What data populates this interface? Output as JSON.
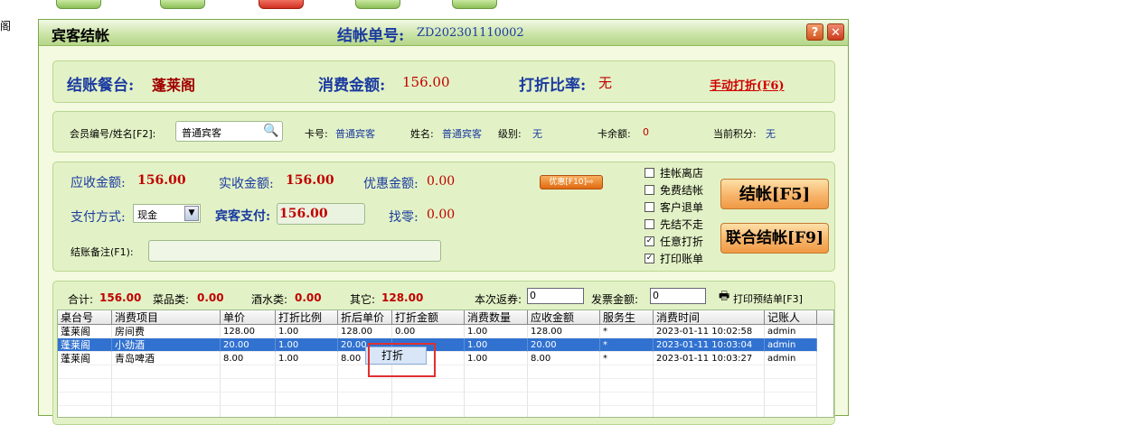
{
  "side_text": "阁",
  "dialog": {
    "title": "宾客结帐",
    "bill_label": "结帐单号:",
    "bill_no": "ZD202301110002"
  },
  "summary": {
    "table_label": "结账餐台:",
    "table_value": "蓬莱阁",
    "amount_label": "消费金额:",
    "amount_value": "156.00",
    "discount_rate_label": "打折比率:",
    "discount_rate_value": "无",
    "manual_discount_link": "手动打折(F6)"
  },
  "member": {
    "id_label": "会员编号/姓名[F2]:",
    "id_value": "普通宾客",
    "card_label": "卡号:",
    "card_value": "普通宾客",
    "name_label": "姓名:",
    "name_value": "普通宾客",
    "level_label": "级别:",
    "level_value": "无",
    "balance_label": "卡余额:",
    "balance_value": "0",
    "points_label": "当前积分:",
    "points_value": "无"
  },
  "payment": {
    "receivable_label": "应收金额:",
    "receivable_value": "156.00",
    "actual_label": "实收金额:",
    "actual_value": "156.00",
    "discount_label": "优惠金额:",
    "discount_value": "0.00",
    "promo_button": "优惠[F10]⇨",
    "method_label": "支付方式:",
    "method_value": "现金",
    "guest_pay_label": "宾客支付:",
    "guest_pay_value": "156.00",
    "change_label": "找零:",
    "change_value": "0.00",
    "remark_label": "结账备注(F1):",
    "remark_value": ""
  },
  "options": [
    {
      "label": "挂帐离店",
      "checked": false
    },
    {
      "label": "免费结帐",
      "checked": false
    },
    {
      "label": "客户退单",
      "checked": false
    },
    {
      "label": "先结不走",
      "checked": false
    },
    {
      "label": "任意打折",
      "checked": true
    },
    {
      "label": "打印账单",
      "checked": true
    }
  ],
  "buttons": {
    "checkout": "结帐[F5]",
    "joint_checkout": "联合结帐[F9]"
  },
  "totals": {
    "total_label": "合计:",
    "total_value": "156.00",
    "dish_label": "菜品类:",
    "dish_value": "0.00",
    "drink_label": "酒水类:",
    "drink_value": "0.00",
    "other_label": "其它:",
    "other_value": "128.00",
    "rebate_label": "本次返券:",
    "rebate_value": "0",
    "invoice_label": "发票金额:",
    "invoice_value": "0",
    "print_pre_label": "打印预结单[F3]"
  },
  "table": {
    "columns": [
      "桌台号",
      "消费项目",
      "单价",
      "打折比例",
      "折后单价",
      "打折金额",
      "消费数量",
      "应收金额",
      "服务生",
      "消费时间",
      "记账人"
    ],
    "rows": [
      [
        "蓬莱阁",
        "房间费",
        "128.00",
        "1.00",
        "128.00",
        "0.00",
        "1.00",
        "128.00",
        "*",
        "2023-01-11 10:02:58",
        "admin"
      ],
      [
        "蓬莱阁",
        "小劲酒",
        "20.00",
        "1.00",
        "20.00",
        "",
        "1.00",
        "20.00",
        "*",
        "2023-01-11 10:03:04",
        "admin"
      ],
      [
        "蓬莱阁",
        "青岛啤酒",
        "8.00",
        "1.00",
        "8.00",
        "",
        "1.00",
        "8.00",
        "*",
        "2023-01-11 10:03:27",
        "admin"
      ]
    ],
    "selected_row": 1
  },
  "context_menu": {
    "items": [
      "打折"
    ]
  }
}
